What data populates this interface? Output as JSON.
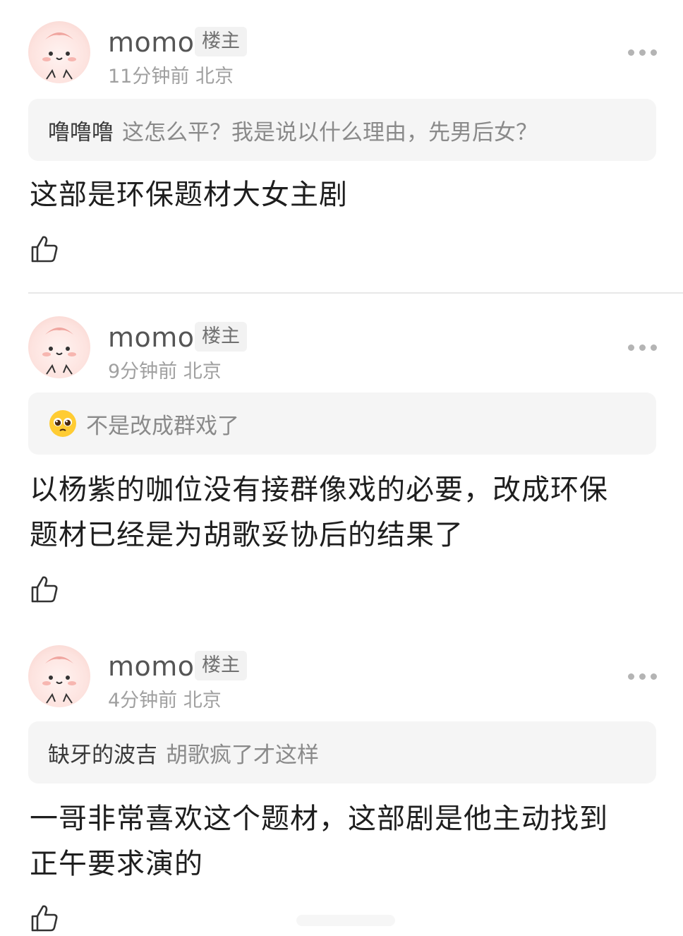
{
  "comments": [
    {
      "username": "momo",
      "badge": "楼主",
      "time": "11分钟前",
      "location": "北京",
      "quote_user": "噜噜噜",
      "quote_text": "这怎么平？我是说以什么理由，先男后女？",
      "quote_icon": "",
      "text_lines": [
        "这部是环保题材大女主剧"
      ]
    },
    {
      "username": "momo",
      "badge": "楼主",
      "time": "9分钟前",
      "location": "北京",
      "quote_user": "",
      "quote_text": "不是改成群戏了",
      "quote_icon": "pleading-face-emoji",
      "text_lines": [
        "以杨紫的咖位没有接群像戏的必要，改成环保",
        "题材已经是为胡歌妥协后的结果了"
      ]
    },
    {
      "username": "momo",
      "badge": "楼主",
      "time": "4分钟前",
      "location": "北京",
      "quote_user": "缺牙的波吉",
      "quote_text": "胡歌疯了才这样",
      "quote_icon": "",
      "text_lines": [
        "一哥非常喜欢这个题材，这部剧是他主动找到",
        "正午要求演的"
      ]
    }
  ],
  "icons": {
    "like": "thumbs-up-icon",
    "more": "more-dots-icon",
    "avatar": "cute-character-avatar"
  },
  "colors": {
    "username": "#555555",
    "meta": "#a0a0a0",
    "quote_bg": "#f5f5f5",
    "badge_bg": "#f2f2f2"
  }
}
